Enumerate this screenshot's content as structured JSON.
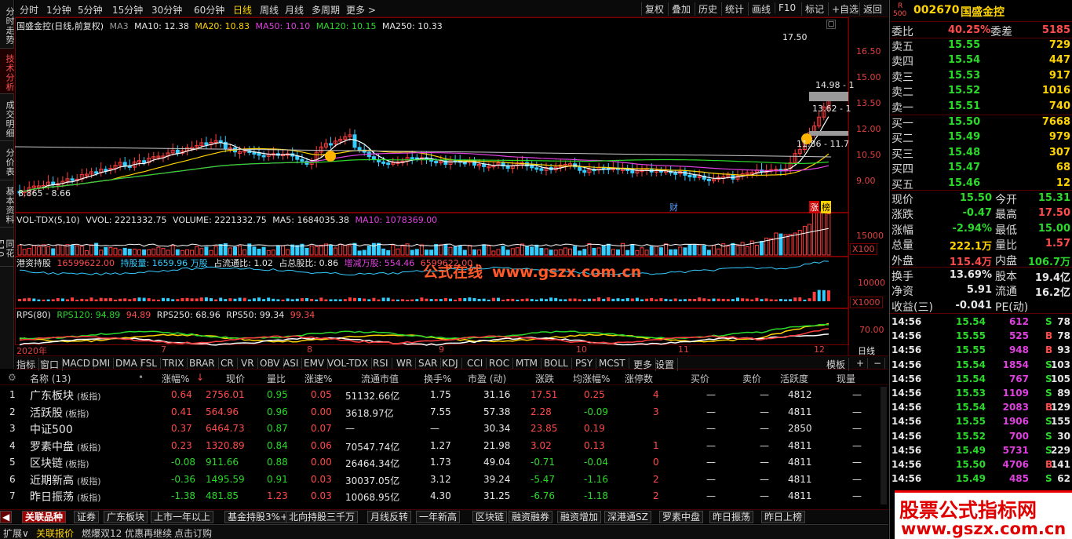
{
  "left_tabs": [
    "分时走势",
    "技术分析",
    "成交明细",
    "分价表",
    "基本资料",
    "同花F10"
  ],
  "top_periods": [
    "分时",
    "1分钟",
    "5分钟",
    "15分钟",
    "30分钟",
    "60分钟",
    "日线",
    "周线",
    "月线",
    "多周期",
    "更多 >"
  ],
  "top_tools": [
    "复权",
    "叠加",
    "历史",
    "统计",
    "画线",
    "F10",
    "标记",
    "+自选",
    "返回"
  ],
  "main_indicator": {
    "name": "国盛金控(日线,前复权)",
    "ma3": "MA3",
    "ma10": "MA10: 12.38",
    "ma20": "MA20: 10.83",
    "ma50": "MA50: 10.10",
    "ma120": "MA120: 10.15",
    "ma250": "MA250: 10.33"
  },
  "price_axis": [
    "16.50",
    "15.00",
    "13.50",
    "12.00",
    "10.50",
    "9.00"
  ],
  "price_marks": {
    "high": "17.50",
    "p1": "14.98 - 1",
    "p2": "13.62 - 1",
    "p3": "11.86 - 11.7",
    "low": "8.865 - 8.66"
  },
  "events": {
    "cai": "财",
    "zhang": "涨",
    "bang": "榜"
  },
  "vol_indicator": {
    "name": "VOL-TDX(5,10)",
    "vvol": "VVOL: 2221332.75",
    "volume": "VOLUME: 2221332.75",
    "ma5": "MA5: 1684035.38",
    "ma10": "MA10: 1078369.00",
    "axis": "15000",
    "unit": "X100"
  },
  "hk_indicator": {
    "name": "港资持股",
    "v1": "16599622.00",
    "v2": "持股量: 1659.96",
    "v3": "万股",
    "v4": "占流通比: 1.02",
    "v5": "占总股比: 0.86",
    "v6": "增减万股: 554.46",
    "v7": "6599622.00",
    "axis": "10000",
    "unit": "X1000"
  },
  "watermark": {
    "a": "公式在线",
    "b": "www.gszx.com.cn"
  },
  "rps_indicator": {
    "name": "RPS(80)",
    "rps120": "RPS120: 94.89",
    "v": "94.89",
    "rps250": "RPS250: 68.96",
    "rps50": "RPS50: 99.34",
    "v2": "99.34",
    "axis": "70.00"
  },
  "time_axis": [
    "2020年",
    "7",
    "8",
    "9",
    "10",
    "11",
    "12"
  ],
  "period_label": "日线",
  "ind_tabs": [
    "指标",
    "窗口",
    "MACD",
    "DMI",
    "DMA",
    "FSL",
    "TRIX",
    "BRAR",
    "CR",
    "VR",
    "OBV",
    "ASI",
    "EMV",
    "VOL-TDX",
    "RSI",
    "WR",
    "SAR",
    "KDJ",
    "CCI",
    "ROC",
    "MTM",
    "BOLL",
    "PSY",
    "MCST",
    "更多",
    "设置"
  ],
  "ind_right": [
    "模板",
    "+",
    "−"
  ],
  "table_headers": [
    "名称 (13)",
    "涨幅%",
    "现价",
    "量比",
    "涨速%",
    "流通市值",
    "换手%",
    "市盈 (动)",
    "涨跌",
    "均涨幅%",
    "涨停数",
    "买价",
    "卖价",
    "活跃度",
    "现量"
  ],
  "rows": [
    {
      "idx": "1",
      "name": "广东板块",
      "tag": "(板指)",
      "chg": "0.64",
      "price": "2756.01",
      "vr": "0.95",
      "speed": "0.05",
      "mv": "51132.66亿",
      "turn": "1.75",
      "pe": "31.16",
      "updown": "17.51",
      "avg": "0.25",
      "limit": "4",
      "buy": "—",
      "sell": "—",
      "act": "4812",
      "vol": "—",
      "dir": "up"
    },
    {
      "idx": "2",
      "name": "活跃股",
      "tag": "(板指)",
      "chg": "0.41",
      "price": "564.96",
      "vr": "0.96",
      "speed": "0.00",
      "mv": "3618.97亿",
      "turn": "7.55",
      "pe": "57.38",
      "updown": "2.28",
      "avg": "-0.09",
      "limit": "3",
      "buy": "—",
      "sell": "—",
      "act": "4811",
      "vol": "—",
      "dir": "up"
    },
    {
      "idx": "3",
      "name": "中证500",
      "tag": "",
      "chg": "0.37",
      "price": "6464.73",
      "vr": "0.87",
      "speed": "0.07",
      "mv": "—",
      "turn": "—",
      "pe": "30.34",
      "updown": "23.85",
      "avg": "0.19",
      "limit": "",
      "buy": "—",
      "sell": "—",
      "act": "2850",
      "vol": "—",
      "dir": "up"
    },
    {
      "idx": "4",
      "name": "罗素中盘",
      "tag": "(板指)",
      "chg": "0.23",
      "price": "1320.89",
      "vr": "0.84",
      "speed": "0.06",
      "mv": "70547.74亿",
      "turn": "1.27",
      "pe": "21.98",
      "updown": "3.02",
      "avg": "0.13",
      "limit": "1",
      "buy": "—",
      "sell": "—",
      "act": "4811",
      "vol": "—",
      "dir": "up"
    },
    {
      "idx": "5",
      "name": "区块链",
      "tag": "(板指)",
      "chg": "-0.08",
      "price": "911.66",
      "vr": "0.88",
      "speed": "0.00",
      "mv": "26464.34亿",
      "turn": "1.73",
      "pe": "49.04",
      "updown": "-0.71",
      "avg": "-0.04",
      "limit": "0",
      "buy": "—",
      "sell": "—",
      "act": "4811",
      "vol": "—",
      "dir": "down"
    },
    {
      "idx": "6",
      "name": "近期新高",
      "tag": "(板指)",
      "chg": "-0.36",
      "price": "1495.59",
      "vr": "0.91",
      "speed": "0.03",
      "mv": "30037.05亿",
      "turn": "3.12",
      "pe": "39.24",
      "updown": "-5.47",
      "avg": "-1.16",
      "limit": "2",
      "buy": "—",
      "sell": "—",
      "act": "4811",
      "vol": "—",
      "dir": "down"
    },
    {
      "idx": "7",
      "name": "昨日振荡",
      "tag": "(板指)",
      "chg": "-1.38",
      "price": "481.85",
      "vr": "1.23",
      "speed": "0.03",
      "mv": "10068.95亿",
      "turn": "4.30",
      "pe": "31.25",
      "updown": "-6.76",
      "avg": "-1.18",
      "limit": "2",
      "buy": "—",
      "sell": "—",
      "act": "4811",
      "vol": "—",
      "dir": "down"
    }
  ],
  "bottom_tabs": [
    "关联品种",
    "证券",
    "广东板块",
    "上市一年以上",
    "基金持股3%+",
    "北向持股三千万",
    "月线反转",
    "一年新高",
    "区块链",
    "融资融券",
    "融资增加",
    "深港通SZ",
    "罗素中盘",
    "昨日振荡",
    "昨日上榜"
  ],
  "status": [
    "扩展∨",
    "关联报价",
    "燃爆双12 优惠再继续",
    "点击订购"
  ],
  "stock": {
    "code": "002670",
    "name": "国盛金控",
    "badge_r": "R",
    "badge_num": "500"
  },
  "ratio": {
    "wb_label": "委比",
    "wb": "40.25%",
    "wc_label": "委差",
    "wc": "5185"
  },
  "asks": [
    {
      "label": "卖五",
      "price": "15.55",
      "vol": "729"
    },
    {
      "label": "卖四",
      "price": "15.54",
      "vol": "447"
    },
    {
      "label": "卖三",
      "price": "15.53",
      "vol": "917"
    },
    {
      "label": "卖二",
      "price": "15.52",
      "vol": "1016"
    },
    {
      "label": "卖一",
      "price": "15.51",
      "vol": "740"
    }
  ],
  "bids": [
    {
      "label": "买一",
      "price": "15.50",
      "vol": "7668"
    },
    {
      "label": "买二",
      "price": "15.49",
      "vol": "979"
    },
    {
      "label": "买三",
      "price": "15.48",
      "vol": "307"
    },
    {
      "label": "买四",
      "price": "15.47",
      "vol": "68"
    },
    {
      "label": "买五",
      "price": "15.46",
      "vol": "12"
    }
  ],
  "quote": [
    {
      "l1": "现价",
      "v1": "15.50",
      "c1": "green",
      "l2": "今开",
      "v2": "15.31",
      "c2": "green"
    },
    {
      "l1": "涨跌",
      "v1": "-0.47",
      "c1": "green",
      "l2": "最高",
      "v2": "17.50",
      "c2": "red"
    },
    {
      "l1": "涨幅",
      "v1": "-2.94%",
      "c1": "green",
      "l2": "最低",
      "v2": "15.00",
      "c2": "green"
    },
    {
      "l1": "总量",
      "v1": "222.1万",
      "c1": "yellow",
      "l2": "量比",
      "v2": "1.57",
      "c2": "red"
    },
    {
      "l1": "外盘",
      "v1": "115.4万",
      "c1": "red",
      "l2": "内盘",
      "v2": "106.7万",
      "c2": "green"
    }
  ],
  "quote2": [
    {
      "l1": "换手",
      "v1": "13.69%",
      "l2": "股本",
      "v2": "19.4亿"
    },
    {
      "l1": "净资",
      "v1": "5.91",
      "l2": "流通",
      "v2": "16.2亿"
    },
    {
      "l1": "收益(三)",
      "v1": "-0.041",
      "l2": "PE(动)",
      "v2": ""
    }
  ],
  "ticks": [
    {
      "t": "14:56",
      "p": "15.54",
      "v": "612",
      "d": "S",
      "n": "78"
    },
    {
      "t": "14:56",
      "p": "15.55",
      "v": "525",
      "d": "B",
      "n": "78"
    },
    {
      "t": "14:56",
      "p": "15.55",
      "v": "948",
      "d": "B",
      "n": "93"
    },
    {
      "t": "14:56",
      "p": "15.54",
      "v": "1854",
      "d": "S",
      "n": "103"
    },
    {
      "t": "14:56",
      "p": "15.54",
      "v": "767",
      "d": "S",
      "n": "105"
    },
    {
      "t": "14:56",
      "p": "15.53",
      "v": "1109",
      "d": "S",
      "n": "89"
    },
    {
      "t": "14:56",
      "p": "15.54",
      "v": "2083",
      "d": "B",
      "n": "129"
    },
    {
      "t": "14:56",
      "p": "15.55",
      "v": "1906",
      "d": "S",
      "n": "155"
    },
    {
      "t": "14:56",
      "p": "15.52",
      "v": "700",
      "d": "S",
      "n": "30"
    },
    {
      "t": "14:56",
      "p": "15.49",
      "v": "5731",
      "d": "S",
      "n": "229"
    },
    {
      "t": "14:56",
      "p": "15.50",
      "v": "4706",
      "d": "B",
      "n": "141"
    },
    {
      "t": "14:56",
      "p": "15.49",
      "v": "485",
      "d": "S",
      "n": "62"
    }
  ],
  "banner": {
    "title": "股票公式指标网",
    "url": "www.gszx.com.cn"
  }
}
